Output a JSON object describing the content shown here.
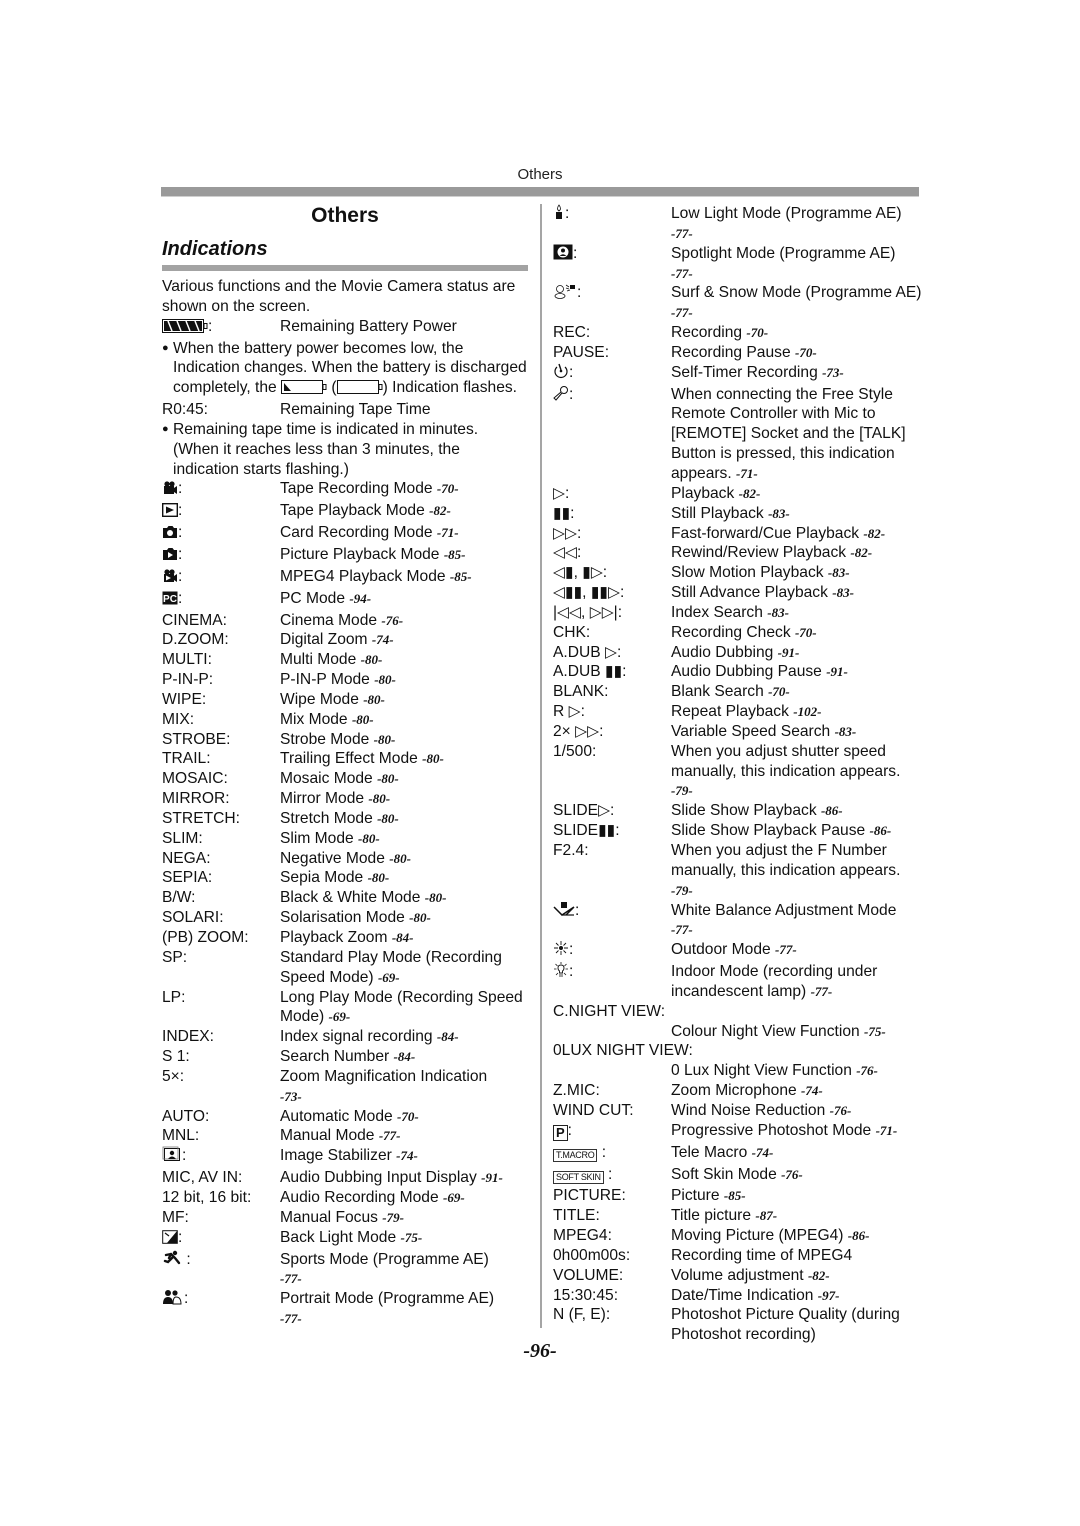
{
  "running_head": "Others",
  "page_number": "-96-",
  "left": {
    "title": "Others",
    "subtitle": "Indications",
    "intro": "Various functions and the Movie Camera status are shown on the screen.",
    "battery": {
      "icon": "battery-full-icon",
      "desc": "Remaining Battery Power"
    },
    "battery_note": {
      "before": "When the battery power becomes low, the Indication changes. When the battery is discharged completely, the",
      "paren_open": "(",
      "paren_close": ")",
      "after": "Indication flashes."
    },
    "tape_time": {
      "key": "R0:45:",
      "desc": "Remaining Tape Time"
    },
    "tape_note": "Remaining tape time is indicated in minutes. (When it reaches less than 3 minutes, the indication starts flashing.)",
    "entries": [
      {
        "icon": "tape-recording-icon",
        "key": ":",
        "desc": "Tape Recording Mode",
        "ref": "-70-"
      },
      {
        "icon": "tape-playback-icon",
        "key": ":",
        "desc": "Tape Playback Mode",
        "ref": "-82-"
      },
      {
        "icon": "card-recording-icon",
        "key": ":",
        "desc": "Card Recording Mode",
        "ref": "-71-"
      },
      {
        "icon": "picture-playback-icon",
        "key": ":",
        "desc": "Picture Playback Mode",
        "ref": "-85-"
      },
      {
        "icon": "mpeg4-playback-icon",
        "key": ":",
        "desc": "MPEG4 Playback Mode",
        "ref": "-85-"
      },
      {
        "icon": "pc-mode-icon",
        "key": ":",
        "desc": "PC Mode",
        "ref": "-94-"
      },
      {
        "key": "CINEMA:",
        "desc": "Cinema Mode",
        "ref": "-76-"
      },
      {
        "key": "D.ZOOM:",
        "desc": "Digital Zoom",
        "ref": "-74-"
      },
      {
        "key": "MULTI:",
        "desc": "Multi Mode",
        "ref": "-80-"
      },
      {
        "key": "P-IN-P:",
        "desc": "P-IN-P Mode",
        "ref": "-80-"
      },
      {
        "key": "WIPE:",
        "desc": "Wipe Mode",
        "ref": "-80-"
      },
      {
        "key": "MIX:",
        "desc": "Mix Mode",
        "ref": "-80-"
      },
      {
        "key": "STROBE:",
        "desc": "Strobe Mode",
        "ref": "-80-"
      },
      {
        "key": "TRAIL:",
        "desc": "Trailing Effect Mode",
        "ref": "-80-"
      },
      {
        "key": "MOSAIC:",
        "desc": "Mosaic Mode",
        "ref": "-80-"
      },
      {
        "key": "MIRROR:",
        "desc": "Mirror Mode",
        "ref": "-80-"
      },
      {
        "key": "STRETCH:",
        "desc": "Stretch Mode",
        "ref": "-80-"
      },
      {
        "key": "SLIM:",
        "desc": "Slim Mode",
        "ref": "-80-"
      },
      {
        "key": "NEGA:",
        "desc": "Negative Mode",
        "ref": "-80-"
      },
      {
        "key": "SEPIA:",
        "desc": "Sepia Mode",
        "ref": "-80-"
      },
      {
        "key": "B/W:",
        "desc": "Black & White Mode",
        "ref": "-80-"
      },
      {
        "key": "SOLARI:",
        "desc": "Solarisation Mode",
        "ref": "-80-"
      },
      {
        "key": "(PB) ZOOM:",
        "desc": "Playback Zoom",
        "ref": "-84-"
      },
      {
        "key": "SP:",
        "desc": "Standard Play Mode (Recording Speed Mode)",
        "ref": "-69-"
      },
      {
        "key": "LP:",
        "desc": "Long Play Mode (Recording Speed Mode)",
        "ref": "-69-"
      },
      {
        "key": "INDEX:",
        "desc": "Index signal recording",
        "ref": "-84-"
      },
      {
        "key": "S 1:",
        "desc": "Search Number",
        "ref": "-84-"
      },
      {
        "key": "5×:",
        "desc": "Zoom Magnification Indication",
        "ref": "-73-",
        "ref_newline": true
      },
      {
        "key": "AUTO:",
        "desc": "Automatic Mode",
        "ref": "-70-"
      },
      {
        "key": "MNL:",
        "desc": "Manual Mode",
        "ref": "-77-"
      },
      {
        "icon": "image-stabilizer-icon",
        "key": ":",
        "desc": "Image Stabilizer",
        "ref": "-74-"
      },
      {
        "key": "MIC, AV IN:",
        "desc": "Audio Dubbing Input Display",
        "ref": "-91-"
      },
      {
        "key": "12 bit, 16 bit:",
        "desc": "Audio Recording Mode",
        "ref": "-69-"
      },
      {
        "key": "MF:",
        "desc": "Manual Focus",
        "ref": "-79-"
      },
      {
        "icon": "back-light-icon",
        "key": ":",
        "desc": "Back Light Mode",
        "ref": "-75-"
      },
      {
        "icon": "sports-mode-icon",
        "key": " :",
        "desc": "Sports Mode (Programme AE)",
        "ref": "-77-",
        "ref_newline": true
      },
      {
        "icon": "portrait-mode-icon",
        "key": ":",
        "desc": "Portrait Mode (Programme AE)",
        "ref": "-77-",
        "ref_newline": true
      }
    ]
  },
  "right": {
    "entries": [
      {
        "icon": "low-light-icon",
        "key": ":",
        "desc": "Low Light Mode (Programme AE)",
        "ref": "-77-",
        "ref_newline": true
      },
      {
        "icon": "spotlight-icon",
        "key": ":",
        "desc": "Spotlight Mode (Programme AE)",
        "ref": "-77-",
        "ref_newline": true
      },
      {
        "icon": "surf-snow-icon",
        "key": ":",
        "desc": "Surf & Snow Mode (Programme AE)",
        "ref": "-77-"
      },
      {
        "key": "REC:",
        "desc": "Recording",
        "ref": "-70-"
      },
      {
        "key": "PAUSE:",
        "desc": "Recording Pause",
        "ref": "-70-"
      },
      {
        "icon": "self-timer-icon",
        "key": ":",
        "desc": "Self-Timer Recording",
        "ref": "-73-"
      },
      {
        "icon": "microphone-icon",
        "key": ":",
        "desc": "When connecting the Free Style Remote Controller with Mic to [REMOTE] Socket and the [TALK] Button is pressed, this indication appears.",
        "ref": "-71-"
      },
      {
        "key": "▷:",
        "desc": "Playback",
        "ref": "-82-"
      },
      {
        "key": "▮▮:",
        "desc": "Still Playback",
        "ref": "-83-"
      },
      {
        "key": "▷▷:",
        "desc": "Fast-forward/Cue Playback",
        "ref": "-82-"
      },
      {
        "key": "◁◁:",
        "desc": "Rewind/Review Playback",
        "ref": "-82-"
      },
      {
        "key": "◁▮, ▮▷:",
        "desc": "Slow Motion Playback",
        "ref": "-83-"
      },
      {
        "key": "◁▮▮, ▮▮▷:",
        "desc": "Still Advance Playback",
        "ref": "-83-"
      },
      {
        "key": "|◁◁, ▷▷|:",
        "desc": "Index Search",
        "ref": "-83-"
      },
      {
        "key": "CHK:",
        "desc": "Recording Check",
        "ref": "-70-"
      },
      {
        "key": "A.DUB ▷:",
        "desc": "Audio Dubbing",
        "ref": "-91-"
      },
      {
        "key": "A.DUB ▮▮:",
        "desc": "Audio Dubbing Pause",
        "ref": "-91-"
      },
      {
        "key": "BLANK:",
        "desc": "Blank Search",
        "ref": "-70-"
      },
      {
        "key": "R ▷:",
        "desc": "Repeat Playback",
        "ref": "-102-"
      },
      {
        "key": "2× ▷▷:",
        "desc": "Variable Speed Search",
        "ref": "-83-"
      },
      {
        "key": "1/500:",
        "desc": "When you adjust shutter speed manually, this indication appears.",
        "ref": "-79-",
        "ref_newline": true
      },
      {
        "key": "SLIDE▷:",
        "desc": "Slide Show Playback",
        "ref": "-86-"
      },
      {
        "key": "SLIDE▮▮:",
        "desc": "Slide Show Playback Pause",
        "ref": "-86-"
      },
      {
        "key": "F2.4:",
        "desc": "When you adjust the F Number manually, this indication appears.",
        "ref": "-79-",
        "ref_newline": true
      },
      {
        "icon": "white-balance-icon",
        "key": ":",
        "desc": "White Balance Adjustment Mode",
        "ref": "-77-",
        "ref_newline": true
      },
      {
        "icon": "outdoor-sun-icon",
        "key": ":",
        "desc": "Outdoor Mode",
        "ref": "-77-"
      },
      {
        "icon": "indoor-lamp-icon",
        "key": ":",
        "desc": "Indoor Mode (recording under incandescent lamp)",
        "ref": "-77-"
      },
      {
        "key": "C.NIGHT VIEW:",
        "desc": "Colour Night View Function",
        "ref": "-75-",
        "key_full_line": true
      },
      {
        "key": "0LUX NIGHT VIEW:",
        "desc": "0 Lux Night View Function",
        "ref": "-76-",
        "key_full_line": true
      },
      {
        "key": "Z.MIC:",
        "desc": "Zoom Microphone",
        "ref": "-74-"
      },
      {
        "key": "WIND CUT:",
        "desc": "Wind Noise Reduction",
        "ref": "-76-"
      },
      {
        "icon": "progressive-p-icon",
        "icon_text": "P",
        "key": ":",
        "desc": "Progressive Photoshot Mode",
        "ref": "-71-"
      },
      {
        "icon": "tele-macro-icon",
        "icon_text": "T.MACRO",
        "key": " :",
        "desc": "Tele Macro",
        "ref": "-74-"
      },
      {
        "icon": "soft-skin-icon",
        "icon_text": "SOFT SKIN",
        "key": " :",
        "desc": "Soft Skin Mode",
        "ref": "-76-"
      },
      {
        "key": "PICTURE:",
        "desc": "Picture",
        "ref": "-85-"
      },
      {
        "key": "TITLE:",
        "desc": "Title picture",
        "ref": "-87-"
      },
      {
        "key": "MPEG4:",
        "desc": "Moving Picture (MPEG4)",
        "ref": "-86-"
      },
      {
        "key": "0h00m00s:",
        "desc": "Recording time of MPEG4",
        "ref": ""
      },
      {
        "key": "VOLUME:",
        "desc": "Volume adjustment",
        "ref": "-82-"
      },
      {
        "key": "15:30:45:",
        "desc": "Date/Time Indication",
        "ref": "-97-"
      },
      {
        "key": "N (F, E):",
        "desc": "Photoshot Picture Quality (during Photoshot recording)",
        "ref": ""
      }
    ]
  }
}
